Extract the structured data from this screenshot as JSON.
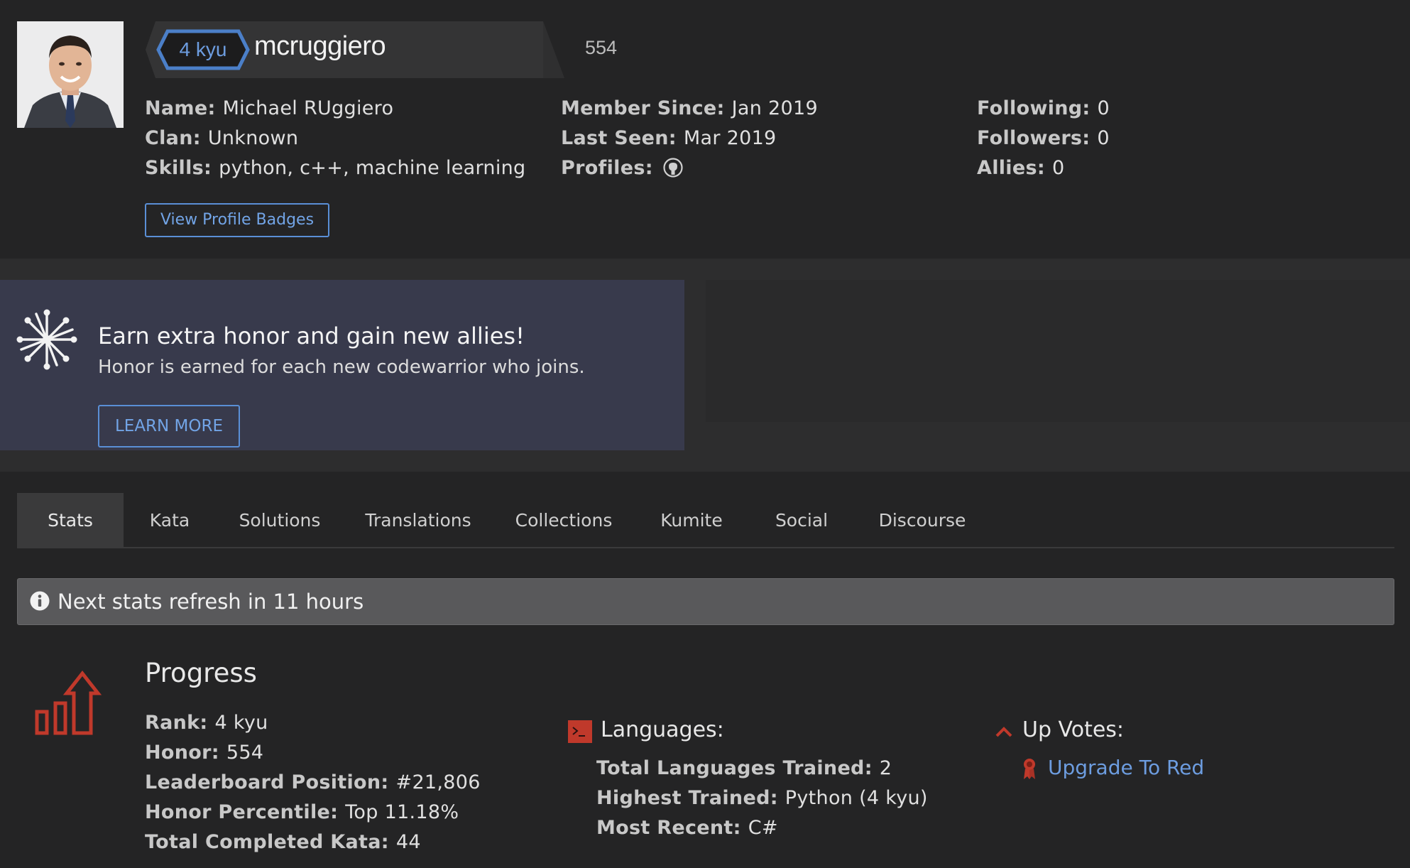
{
  "profile": {
    "avatar_alt": "avatar",
    "rank": "4 kyu",
    "username": "mcruggiero",
    "honor": "554",
    "col1": [
      {
        "label": "Name:",
        "value": "Michael RUggiero"
      },
      {
        "label": "Clan:",
        "value": "Unknown"
      },
      {
        "label": "Skills:",
        "value": "python, c++, machine learning"
      }
    ],
    "col2": [
      {
        "label": "Member Since:",
        "value": "Jan 2019"
      },
      {
        "label": "Last Seen:",
        "value": "Mar 2019"
      },
      {
        "label": "Profiles:",
        "value": ""
      }
    ],
    "col3": [
      {
        "label": "Following:",
        "value": "0"
      },
      {
        "label": "Followers:",
        "value": "0"
      },
      {
        "label": "Allies:",
        "value": "0"
      }
    ],
    "badges_button": "View Profile Badges",
    "profiles_icon": "github-icon"
  },
  "promo": {
    "title": "Earn extra honor and gain new allies!",
    "subtitle": "Honor is earned for each new codewarrior who joins.",
    "button": "LEARN MORE"
  },
  "tabs": [
    {
      "label": "Stats",
      "active": true
    },
    {
      "label": "Kata",
      "active": false
    },
    {
      "label": "Solutions",
      "active": false
    },
    {
      "label": "Translations",
      "active": false
    },
    {
      "label": "Collections",
      "active": false
    },
    {
      "label": "Kumite",
      "active": false
    },
    {
      "label": "Social",
      "active": false
    },
    {
      "label": "Discourse",
      "active": false
    }
  ],
  "notice": {
    "text": "Next stats refresh in 11 hours",
    "icon": "info-icon"
  },
  "progress": {
    "title": "Progress",
    "rows": [
      {
        "label": "Rank:",
        "value": "4 kyu"
      },
      {
        "label": "Honor:",
        "value": "554"
      },
      {
        "label": "Leaderboard Position:",
        "value": "#21,806"
      },
      {
        "label": "Honor Percentile:",
        "value": "Top 11.18%"
      },
      {
        "label": "Total Completed Kata:",
        "value": "44"
      }
    ]
  },
  "languages": {
    "title": "Languages:",
    "rows": [
      {
        "label": "Total Languages Trained:",
        "value": "2"
      },
      {
        "label": "Highest Trained:",
        "value": "Python (4 kyu)"
      },
      {
        "label": "Most Recent:",
        "value": "C#"
      }
    ]
  },
  "upvotes": {
    "title": "Up Votes:",
    "link": "Upgrade To Red"
  },
  "colors": {
    "background": "#242425",
    "accent_blue": "#5a8fd6",
    "accent_red": "#c0392b",
    "promo_bg": "#383a4c"
  }
}
